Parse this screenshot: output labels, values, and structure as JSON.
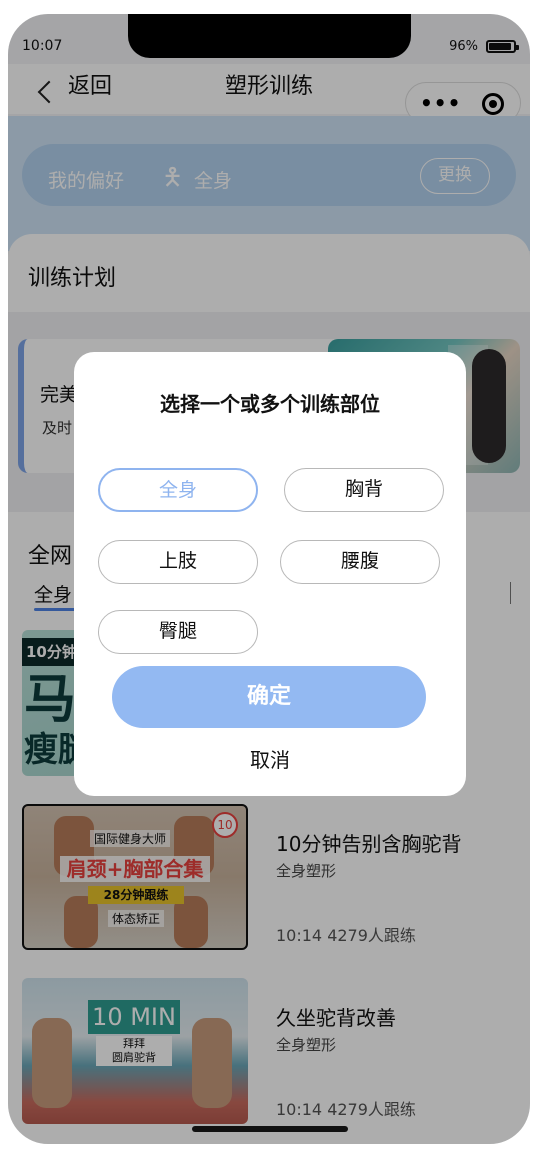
{
  "status_bar": {
    "time": "10:07",
    "battery": "96%"
  },
  "nav": {
    "back_label": "返回",
    "title": "塑形训练",
    "capsule_more": "•••"
  },
  "preference": {
    "label": "我的偏好",
    "value": "全身",
    "change_label": "更换"
  },
  "plan": {
    "title": "训练计划",
    "item_title": "完美",
    "item_sub": "及时"
  },
  "list": {
    "title": "全网",
    "active_tab": "全身",
    "videos": [
      {
        "title": "",
        "category": "",
        "stats": "",
        "thumb_badge": "10分钟",
        "thumb_big1": "马",
        "thumb_big2": "瘦腿"
      },
      {
        "title": "10分钟告别含胸驼背",
        "category": "全身塑形",
        "stats": "10:14 4279人跟练",
        "thumb_top": "国际健身大师",
        "thumb_banner": "肩颈+胸部合集",
        "thumb_badge": "28分钟跟练",
        "thumb_sub": "体态矫正",
        "thumb_num": "10"
      },
      {
        "title": "久坐驼背改善",
        "category": "全身塑形",
        "stats": "10:14 4279人跟练",
        "thumb_tag": "10 MIN",
        "thumb_tag2_a": "拜拜",
        "thumb_tag2_b": "圆肩驼背"
      }
    ]
  },
  "modal": {
    "title": "选择一个或多个训练部位",
    "options": [
      "全身",
      "胸背",
      "上肢",
      "腰腹",
      "臀腿"
    ],
    "selected": "全身",
    "confirm_label": "确定",
    "cancel_label": "取消"
  },
  "colors": {
    "accent": "#93b9f2",
    "selected_border": "#8fb4ef",
    "pref_bg": "#cfe4f6",
    "tab_underline": "#4f84e6"
  }
}
